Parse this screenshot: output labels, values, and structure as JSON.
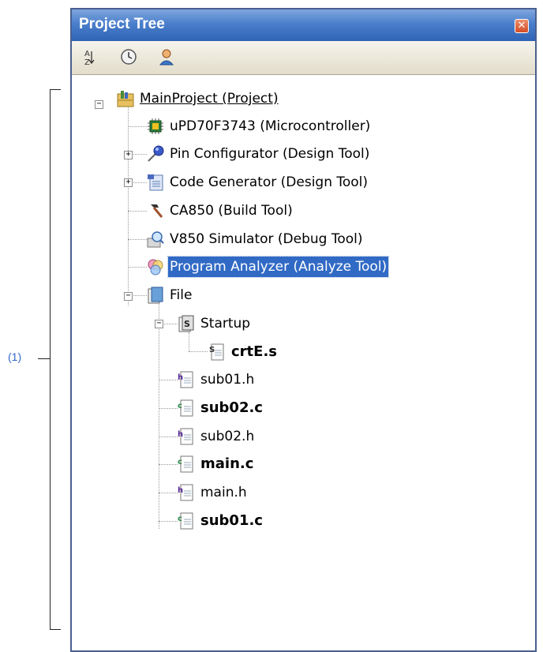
{
  "annotation": {
    "label": "(1)"
  },
  "panel": {
    "title": "Project Tree",
    "close_symbol": "✕",
    "toolbar": [
      {
        "name": "sort-icon",
        "tooltip": ""
      },
      {
        "name": "clock-icon",
        "tooltip": ""
      },
      {
        "name": "user-icon",
        "tooltip": ""
      }
    ]
  },
  "tree": {
    "project": {
      "label": "MainProject (Project)",
      "icon": "project-icon",
      "expanded": true
    },
    "items": [
      {
        "label": "uPD70F3743 (Microcontroller)",
        "icon": "microcontroller-icon",
        "expandable": false
      },
      {
        "label": "Pin Configurator (Design Tool)",
        "icon": "pin-configurator-icon",
        "expandable": true,
        "expanded": false
      },
      {
        "label": "Code Generator (Design Tool)",
        "icon": "code-generator-icon",
        "expandable": true,
        "expanded": false
      },
      {
        "label": "CA850 (Build Tool)",
        "icon": "hammer-icon",
        "expandable": false
      },
      {
        "label": "V850 Simulator (Debug Tool)",
        "icon": "simulator-icon",
        "expandable": false
      },
      {
        "label": "Program Analyzer (Analyze Tool)",
        "icon": "analyzer-icon",
        "expandable": false,
        "selected": true
      },
      {
        "label": "File",
        "icon": "folder-icon",
        "expandable": true,
        "expanded": true
      }
    ],
    "file_children": {
      "startup": {
        "label": "Startup",
        "icon": "s-folder-icon",
        "expanded": true
      },
      "startup_files": [
        {
          "label": "crtE.s",
          "icon": "s-file-icon",
          "bold": true
        }
      ],
      "files": [
        {
          "label": "sub01.h",
          "icon": "h-file-icon",
          "bold": false
        },
        {
          "label": "sub02.c",
          "icon": "c-file-icon",
          "bold": true
        },
        {
          "label": "sub02.h",
          "icon": "h-file-icon",
          "bold": false
        },
        {
          "label": "main.c",
          "icon": "c-file-icon",
          "bold": true
        },
        {
          "label": "main.h",
          "icon": "h-file-icon",
          "bold": false
        },
        {
          "label": "sub01.c",
          "icon": "c-file-icon",
          "bold": true
        }
      ]
    }
  }
}
